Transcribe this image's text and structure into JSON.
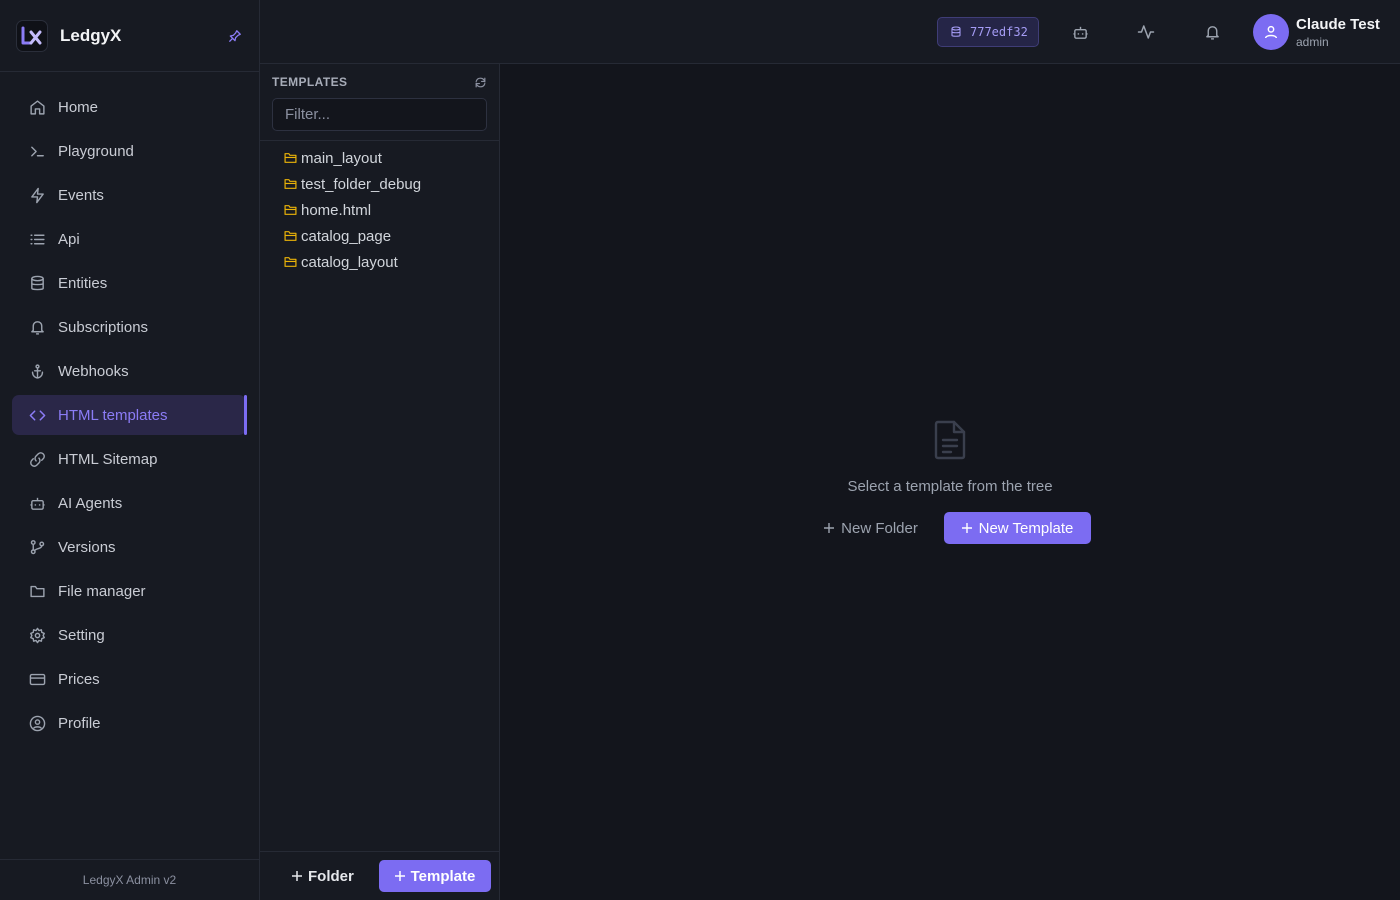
{
  "app": {
    "name": "LedgyX",
    "footer": "LedgyX Admin v2"
  },
  "colors": {
    "accent": "#7c6cf2",
    "active_text": "#8b7cf6",
    "folder": "#eab308"
  },
  "sidebar": {
    "items": [
      {
        "label": "Home",
        "icon": "home-icon"
      },
      {
        "label": "Playground",
        "icon": "terminal-icon"
      },
      {
        "label": "Events",
        "icon": "lightning-icon"
      },
      {
        "label": "Api",
        "icon": "list-icon"
      },
      {
        "label": "Entities",
        "icon": "database-icon"
      },
      {
        "label": "Subscriptions",
        "icon": "bell-icon"
      },
      {
        "label": "Webhooks",
        "icon": "anchor-icon"
      },
      {
        "label": "HTML templates",
        "icon": "code-icon",
        "active": true
      },
      {
        "label": "HTML Sitemap",
        "icon": "link-icon"
      },
      {
        "label": "AI Agents",
        "icon": "robot-icon"
      },
      {
        "label": "Versions",
        "icon": "git-branch-icon"
      },
      {
        "label": "File manager",
        "icon": "folder-icon"
      },
      {
        "label": "Setting",
        "icon": "gear-icon"
      },
      {
        "label": "Prices",
        "icon": "credit-card-icon"
      },
      {
        "label": "Profile",
        "icon": "user-circle-icon"
      }
    ]
  },
  "topbar": {
    "db_badge": "777edf32",
    "user": {
      "name": "Claude Test",
      "role": "admin"
    }
  },
  "templates": {
    "heading": "TEMPLATES",
    "filter_placeholder": "Filter...",
    "filter_value": "",
    "tree": [
      "main_layout",
      "test_folder_debug",
      "home.html",
      "catalog_page",
      "catalog_layout"
    ],
    "folder_button": "Folder",
    "template_button": "Template"
  },
  "main": {
    "empty_text": "Select a template from the tree",
    "new_folder": "New Folder",
    "new_template": "New Template"
  }
}
